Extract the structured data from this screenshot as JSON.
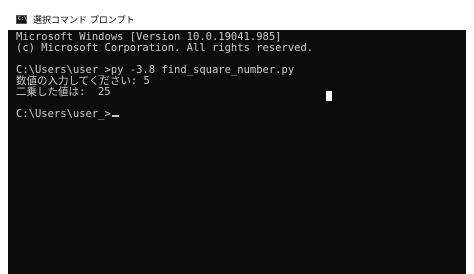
{
  "window": {
    "title": "選択コマンド プロンプト",
    "icon": "cmd-prompt-icon"
  },
  "console": {
    "lines": [
      "Microsoft Windows [Version 10.0.19041.985]",
      "(c) Microsoft Corporation. All rights reserved.",
      "",
      "C:\\Users\\user_>py -3.8 find_square_number.py",
      "数値の入力してください: 5",
      "二乗した値は:  25",
      ""
    ],
    "prompt": "C:\\Users\\user_>",
    "colors": {
      "background": "#0c0c0c",
      "text": "#cccccc"
    }
  }
}
